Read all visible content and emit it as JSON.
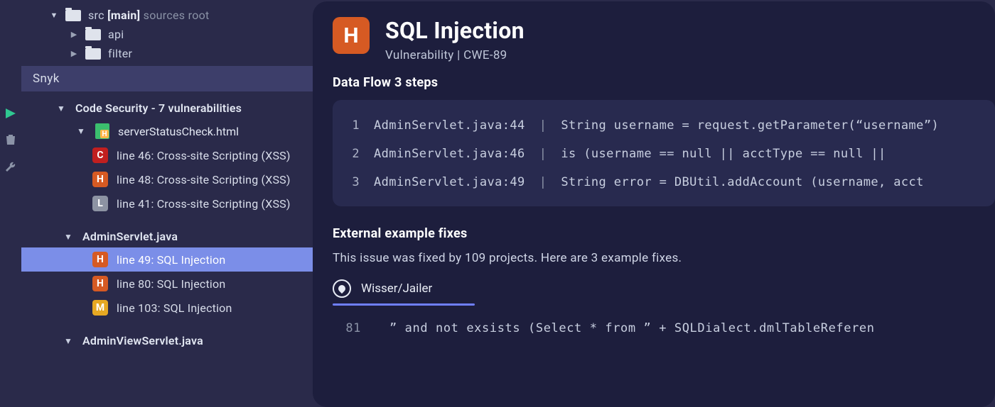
{
  "filetree": {
    "root": {
      "name": "src",
      "branch": "[main]",
      "note": "sources root"
    },
    "children": [
      {
        "name": "api"
      },
      {
        "name": "filter"
      }
    ]
  },
  "side_section": "Snyk",
  "vuln_tree": {
    "header": "Code Security - 7 vulnerabilities",
    "groups": [
      {
        "file": "serverStatusCheck.html",
        "items": [
          {
            "sev": "C",
            "label": "line 46: Cross-site Scripting (XSS)",
            "selected": false
          },
          {
            "sev": "H",
            "label": "line 48: Cross-site Scripting (XSS)",
            "selected": false
          },
          {
            "sev": "L",
            "label": "line 41: Cross-site Scripting (XSS)",
            "selected": false
          }
        ]
      },
      {
        "file": "AdminServlet.java",
        "items": [
          {
            "sev": "H",
            "label": "line 49: SQL Injection",
            "selected": true
          },
          {
            "sev": "H",
            "label": "line 80: SQL Injection",
            "selected": false
          },
          {
            "sev": "M",
            "label": "line 103: SQL Injection",
            "selected": false
          }
        ]
      },
      {
        "file": "AdminViewServlet.java",
        "items": []
      }
    ]
  },
  "detail": {
    "sev": "H",
    "title": "SQL Injection",
    "subtitle": "Vulnerability | CWE-89",
    "dataflow_header": "Data Flow 3 steps",
    "steps": [
      {
        "n": "1",
        "loc": "AdminServlet.java:44",
        "code": "String username = request.getParameter(“username”)"
      },
      {
        "n": "2",
        "loc": "AdminServlet.java:46",
        "code": "is (username == null || acctType == null ||"
      },
      {
        "n": "3",
        "loc": "AdminServlet.java:49",
        "code": "String error = DBUtil.addAccount (username, acct"
      }
    ],
    "ext_header": "External example fixes",
    "ext_desc": "This issue was fixed by 109 projects. Here are 3 example fixes.",
    "fix_tab": "Wisser/Jailer",
    "code_ln": "81",
    "code_txt": "” and not exsists (Select * from ” + SQLDialect.dmlTableReferen"
  }
}
